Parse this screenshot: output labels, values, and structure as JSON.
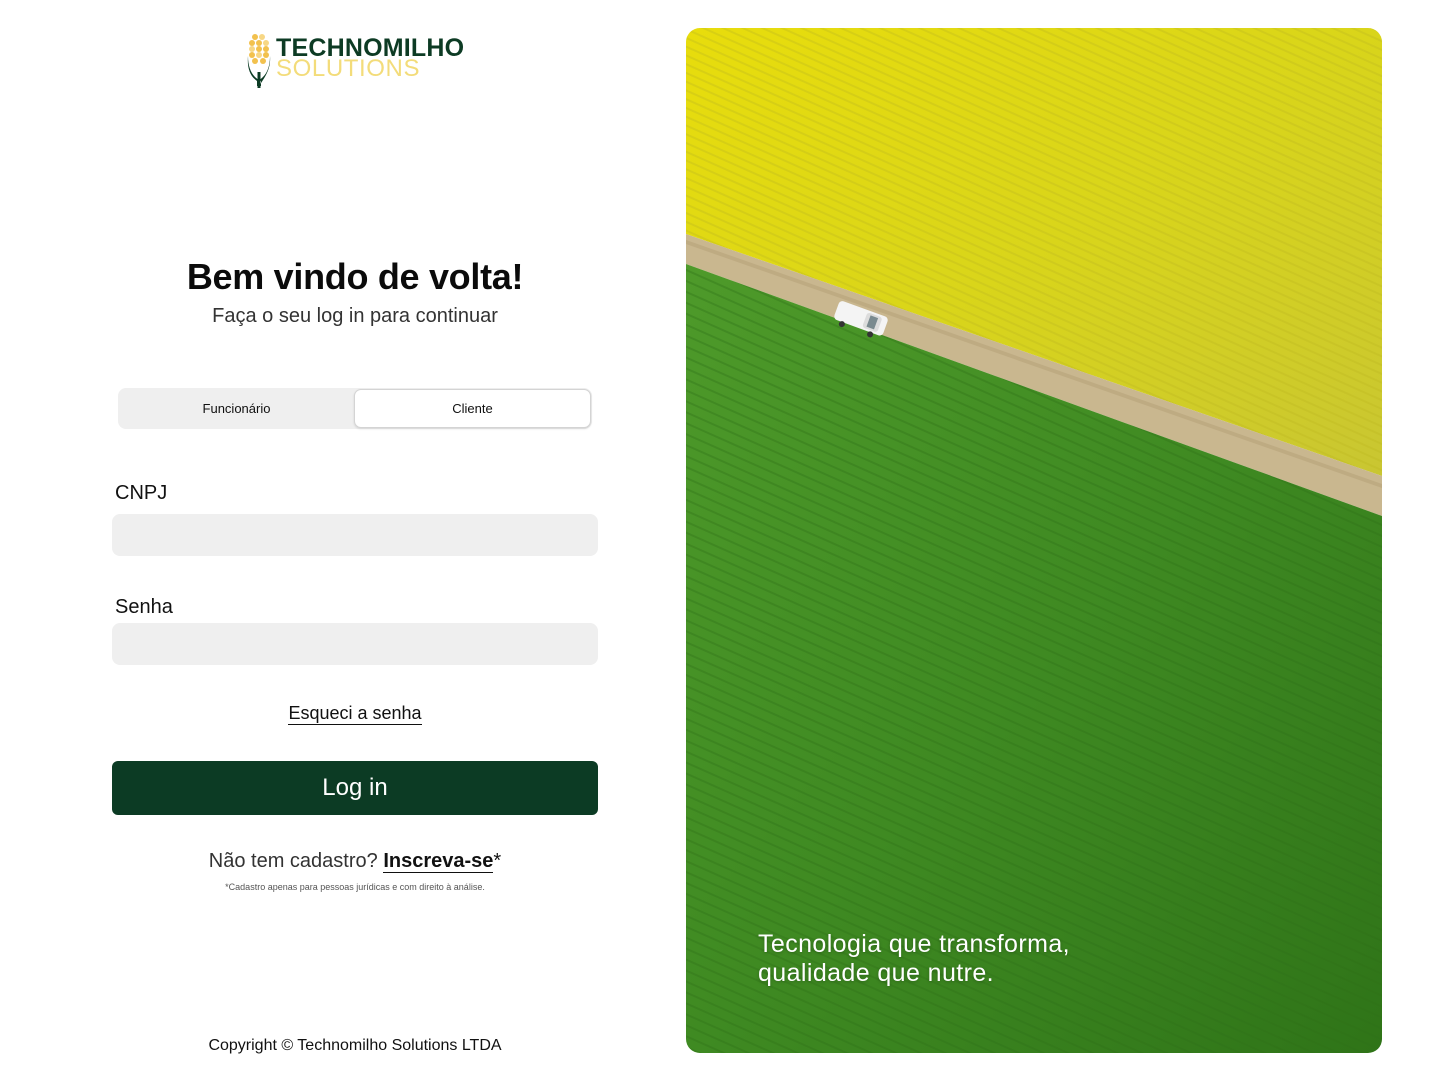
{
  "brand": {
    "name": "TECHNOMILHO",
    "sub": "SOLUTIONS",
    "colors": {
      "primary": "#0c3b24",
      "accent": "#f3dc7a",
      "corn": "#f2c14e"
    }
  },
  "header": {
    "title": "Bem vindo de volta!",
    "subtitle": "Faça o seu log in para continuar"
  },
  "toggle": {
    "options": [
      "Funcionário",
      "Cliente"
    ],
    "selected": "Cliente"
  },
  "form": {
    "cnpj_label": "CNPJ",
    "cnpj_value": "",
    "password_label": "Senha",
    "password_value": "",
    "forgot_label": "Esqueci a senha",
    "login_label": "Log in"
  },
  "signup": {
    "prompt": "Não tem cadastro?",
    "link": "Inscreva-se",
    "marker": "*",
    "note": "*Cadastro apenas para pessoas jurídicas e com direito à análise."
  },
  "footer": {
    "copyright": "Copyright © Technomilho Solutions LTDA"
  },
  "hero": {
    "tagline_line1": "Tecnologia que transforma,",
    "tagline_line2": "qualidade que nutre."
  }
}
